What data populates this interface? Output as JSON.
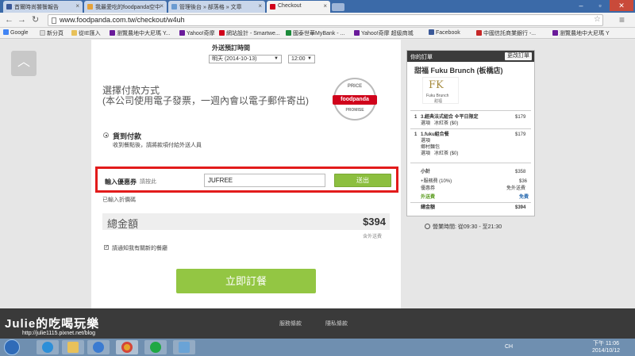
{
  "browser": {
    "tabs": [
      {
        "label": "首爾時尚饕餮報告"
      },
      {
        "label": "我最愛吃的foodpanda空中"
      },
      {
        "label": "管理後台 » 部落格 » 文章"
      },
      {
        "label": "Checkout"
      }
    ],
    "url": "www.foodpanda.com.tw/checkout/w4uh",
    "bookmarks": [
      "Google",
      "新分頁",
      "從IE匯入",
      "瀏覽農地中大尼瑪 Y...",
      "Yahoo!奇摩",
      "網站設計 - Smartwe...",
      "國泰世華MyBank - ...",
      "Yahoo!奇摩 超級商城",
      "Facebook",
      "中國信託商業銀行 -...",
      "瀏覽農地中大尼瑪 Y"
    ]
  },
  "checkout": {
    "delivery_time_label": "外送預訂時間",
    "date_value": "明天 (2014-10-13)",
    "time_value": "12:00",
    "payment_title_line1": "選擇付款方式",
    "payment_title_line2": "(本公司使用電子發票，一週內會以電子郵件寄出)",
    "price_promise_top": "PRICE",
    "price_promise_brand": "foodpanda",
    "price_promise_bottom": "PROMISE",
    "cod_title": "貨到付款",
    "cod_desc": "收到餐點後，請將款項付給外送人員",
    "coupon_label": "輸入優惠券",
    "coupon_hint": "請按此",
    "coupon_value": "JUFREE",
    "coupon_button": "送出",
    "coupon_applied": "已輸入折價碼",
    "total_label": "總金額",
    "total_amount": "$394",
    "fee_note": "含外送費",
    "notify_label": "請通知我有關新的餐廳",
    "place_order": "立即訂餐"
  },
  "cart": {
    "title": "你的訂單",
    "edit_button": "更改訂單",
    "restaurant": "甜福 Fuku Brunch (板橋店)",
    "logo_mark": "FK",
    "logo_text": "Fuku Brunch",
    "logo_sub": "甜福",
    "items": [
      {
        "qty": "1",
        "name": "3.經典法式組合 ※平日限定",
        "price": "$179",
        "opt1": "選項",
        "opt2": "冰紅茶 ($0)"
      },
      {
        "qty": "1",
        "name": "1.fuku組合餐",
        "price": "$179",
        "opt1": "選項",
        "opt2": "鄉村麵包",
        "opt3": "選項",
        "opt4": "冰紅茶 ($0)"
      }
    ],
    "subtotal_label": "小計",
    "subtotal": "$358",
    "service_label": "+服務費 (10%)",
    "service": "$36",
    "coupon_label": "優惠券",
    "coupon": "免外送費",
    "delivery_label": "外送費",
    "delivery": "免費",
    "total_label": "總金額",
    "total": "$394",
    "hours": "營業時間: 從09:30 - 至21:30"
  },
  "footer": {
    "links": [
      "服務條款",
      "隱私條款"
    ],
    "watermark": "Julie的吃喝玩樂",
    "watermark_url": "http://julie1115.pixnet.net/blog"
  },
  "taskbar": {
    "lang": "CH",
    "time": "下午 11:06",
    "date": "2014/10/12"
  },
  "colors": {
    "accent_green": "#8cbf3f",
    "highlight_red": "#e21b1b",
    "brand_red": "#d0021b"
  }
}
